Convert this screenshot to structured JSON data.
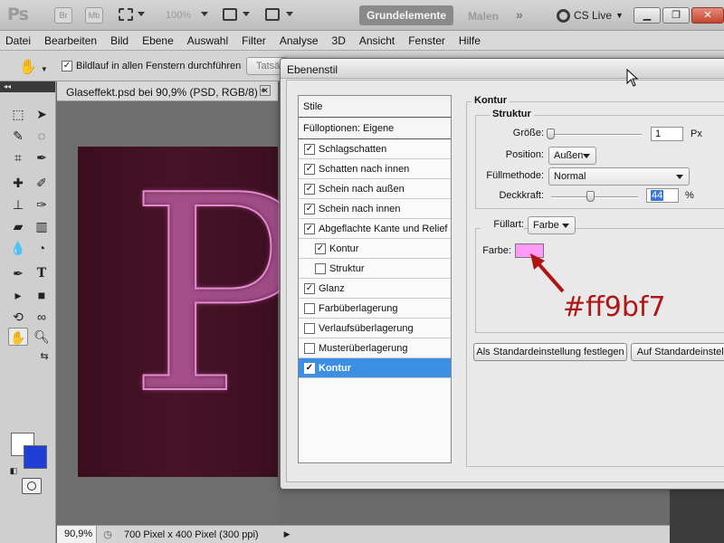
{
  "app": {
    "logo": "Ps",
    "bridge_badge": "Br",
    "minibridge_badge": "Mb",
    "zoom": "100%",
    "workspace_active": "Grundelemente",
    "workspace_other": "Malen",
    "more": "»",
    "cs_live": "CS Live"
  },
  "menu": [
    "Datei",
    "Bearbeiten",
    "Bild",
    "Ebene",
    "Auswahl",
    "Filter",
    "Analyse",
    "3D",
    "Ansicht",
    "Fenster",
    "Hilfe"
  ],
  "options": {
    "scroll_all_label": "Bildlauf in allen Fenstern durchführen",
    "scroll_all_checked": "✓",
    "actual_button": "Tatsä"
  },
  "document": {
    "tab_title": "Glaseffekt.psd bei 90,9% (PSD, RGB/8) *",
    "letter": "P",
    "canvas_color": "#3f1022"
  },
  "status": {
    "zoom": "90,9%",
    "info": "700 Pixel x 400 Pixel (300 ppi)"
  },
  "dialog": {
    "title": "Ebenenstil",
    "styles_header": "Stile",
    "blend_options": "Fülloptionen: Eigene",
    "styles": [
      {
        "label": "Schlagschatten",
        "check": "✓"
      },
      {
        "label": "Schatten nach innen",
        "check": "✓"
      },
      {
        "label": "Schein nach außen",
        "check": "✓"
      },
      {
        "label": "Schein nach innen",
        "check": "✓"
      },
      {
        "label": "Abgeflachte Kante und Relief",
        "check": "✓"
      },
      {
        "label": "Kontur",
        "check": "✓"
      },
      {
        "label": "Struktur",
        "check": ""
      },
      {
        "label": "Glanz",
        "check": "✓"
      },
      {
        "label": "Farbüberlagerung",
        "check": ""
      },
      {
        "label": "Verlaufsüberlagerung",
        "check": ""
      },
      {
        "label": "Musterüberlagerung",
        "check": ""
      },
      {
        "label": "Kontur",
        "check": "✓"
      }
    ],
    "section_title": "Kontur",
    "structure_title": "Struktur",
    "size_label": "Größe:",
    "size_value": "1",
    "size_unit": "Px",
    "position_label": "Position:",
    "position_value": "Außen",
    "blend_label": "Füllmethode:",
    "blend_value": "Normal",
    "opacity_label": "Deckkraft:",
    "opacity_value": "44",
    "opacity_unit": "%",
    "filltype_label": "Füllart:",
    "filltype_value": "Farbe",
    "color_label": "Farbe:",
    "color_value": "#ff9bf7",
    "btn_set_default": "Als Standardeinstellung festlegen",
    "btn_reset_default": "Auf Standardeinstellu"
  },
  "annotation": "#ff9bf7",
  "accent": "#3c8fe3"
}
